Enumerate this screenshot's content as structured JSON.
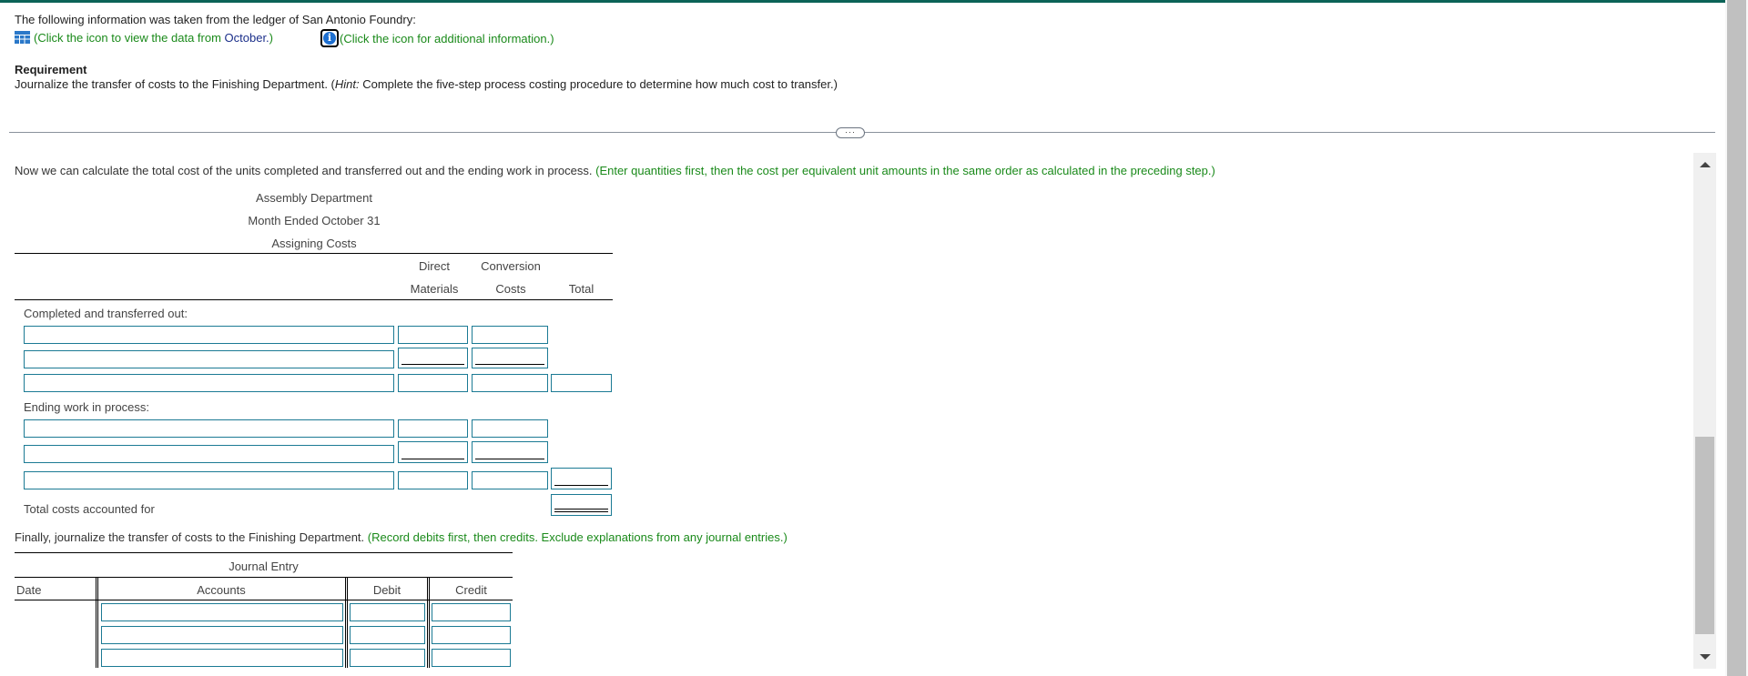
{
  "intro": {
    "text": "The following information was taken from the ledger of San Antonio Foundry:",
    "data_link_prefix": "(Click the icon to view the data from ",
    "data_link_month": "October.",
    "data_link_suffix": ")",
    "info_link": "(Click the icon for additional information.)",
    "icons": {
      "data": "table-grid-icon",
      "info": "info-icon"
    }
  },
  "requirement": {
    "heading": "Requirement",
    "text_prefix": "Journalize the transfer of costs to the Finishing Department. (",
    "hint_label": "Hint:",
    "text_suffix": " Complete the five-step process costing procedure to determine how much cost to transfer.)"
  },
  "divider": {
    "pill_label": "···"
  },
  "step": {
    "text": "Now we can calculate the total cost of the units completed and transferred out and the ending work in process.",
    "instruction": "(Enter quantities first, then the cost per equivalent unit amounts in the same order as calculated in the preceding step.)"
  },
  "assigning_costs": {
    "title_lines": [
      "Assembly Department",
      "Month Ended October 31",
      "Assigning Costs"
    ],
    "columns": [
      {
        "line1": "Direct",
        "line2": "Materials"
      },
      {
        "line1": "Conversion",
        "line2": "Costs"
      },
      {
        "line1": "",
        "line2": "Total"
      }
    ],
    "sections": [
      {
        "label": "Completed and transferred out:"
      },
      {
        "label": "Ending work in process:"
      }
    ],
    "total_label": "Total costs accounted for"
  },
  "journal": {
    "text": "Finally, journalize the transfer of costs to the Finishing Department.",
    "instruction": "(Record debits first, then credits. Exclude explanations from any journal entries.)",
    "title": "Journal Entry",
    "columns": [
      "Date",
      "Accounts",
      "Debit",
      "Credit"
    ],
    "rows": [
      {
        "account": "",
        "debit": "",
        "credit": ""
      },
      {
        "account": "",
        "debit": "",
        "credit": ""
      },
      {
        "account": "",
        "debit": "",
        "credit": ""
      }
    ]
  },
  "colors": {
    "top_bar": "#0b6357",
    "instruction_green": "#1a8a1a",
    "input_border": "#1b7a94",
    "link_navy": "#1b2f8a"
  }
}
